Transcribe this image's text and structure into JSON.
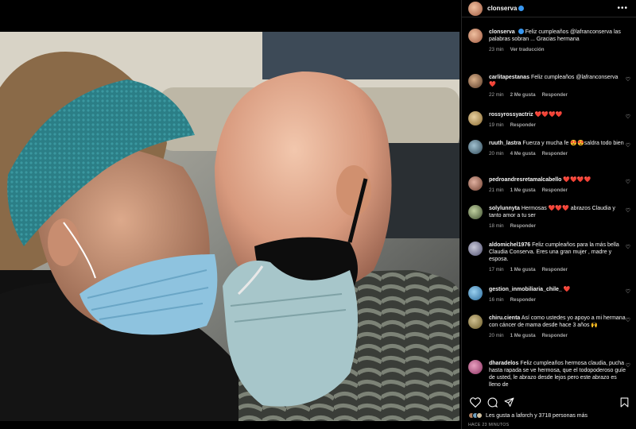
{
  "post": {
    "username": "clonserva"
  },
  "comments": [
    {
      "user": "clonserva",
      "text": "Feliz cumpleaños @lafranconserva las palabras sobran ... Gracias hermana",
      "time": "23 min",
      "action": "Ver traducción",
      "verified": true
    },
    {
      "user": "carlitapestanas",
      "text": "Feliz cumpleaños @lafranconserva ❤️",
      "time": "22 min",
      "likes": "2 Me gusta",
      "reply": "Responder"
    },
    {
      "user": "rossyrossyactriz",
      "text": "❤️❤️❤️❤️",
      "time": "19 min",
      "reply": "Responder"
    },
    {
      "user": "ruuth_lastra",
      "text": "Fuerza y mucha fe 😍😍saldra todo bien",
      "time": "20 min",
      "likes": "4 Me gusta",
      "reply": "Responder"
    },
    {
      "user": "pedroandresretamalcabello",
      "text": "❤️❤️❤️❤️",
      "time": "21 min",
      "likes": "1 Me gusta",
      "reply": "Responder"
    },
    {
      "user": "solylunnyta",
      "text": "Hermosas ❤️❤️❤️ abrazos Claudia y tanto amor a tu ser",
      "time": "18 min",
      "reply": "Responder"
    },
    {
      "user": "aldomichel1976",
      "text": "Feliz cumpleaños para la más bella Claudia Conserva. Eres una gran mujer , madre y esposa.",
      "time": "17 min",
      "likes": "1 Me gusta",
      "reply": "Responder"
    },
    {
      "user": "gestion_inmobiliaria_chile_",
      "text": "❤️",
      "time": "16 min",
      "reply": "Responder"
    },
    {
      "user": "chiru.cienta",
      "text": "Así como ustedes yo apoyo a mi hermana con cáncer de mama desde hace 3 años 🙌",
      "time": "20 min",
      "likes": "1 Me gusta",
      "reply": "Responder"
    },
    {
      "user": "dharadelos",
      "text": "Feliz cumpleaños hermosa claudia, pucha hasta rapada se ve hermosa, que el todopoderoso guíe de usted, le abrazo desde lejos pero este abrazo es lleno de",
      "time": "",
      "reply": ""
    }
  ],
  "footer": {
    "likes_text": "Les gusta a laforch y 3718 personas más",
    "time_ago": "HACE 23 MINUTOS"
  },
  "colors": {
    "background": "#000000",
    "text": "#f5f5f5",
    "muted": "#a8a8a8",
    "heart": "#ed4956",
    "verified": "#3897f0"
  }
}
